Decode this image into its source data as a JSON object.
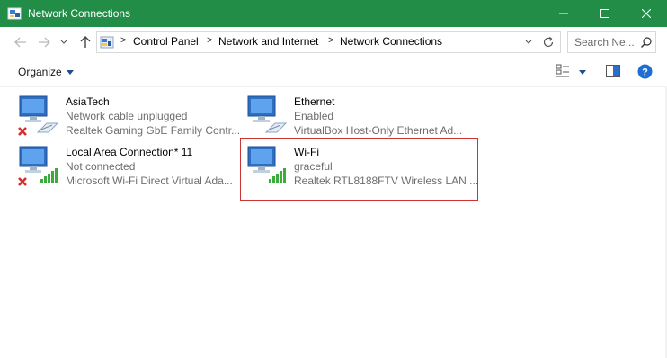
{
  "window": {
    "title": "Network Connections",
    "accent_color": "#218d47",
    "controls": [
      "minimize-icon",
      "maximize-icon",
      "close-icon"
    ]
  },
  "address_bar": {
    "breadcrumbs": [
      "Control Panel",
      "Network and Internet",
      "Network Connections"
    ],
    "search_placeholder": "Search Ne..."
  },
  "command_bar": {
    "organize_label": "Organize"
  },
  "connections": [
    {
      "name": "AsiaTech",
      "status": "Network cable unplugged",
      "device": "Realtek Gaming GbE Family Contr...",
      "type": "ethernet",
      "disconnected": true
    },
    {
      "name": "Ethernet",
      "status": "Enabled",
      "device": "VirtualBox Host-Only Ethernet Ad...",
      "type": "ethernet",
      "disconnected": false
    },
    {
      "name": "Local Area Connection* 11",
      "status": "Not connected",
      "device": "Microsoft Wi-Fi Direct Virtual Ada...",
      "type": "wifi",
      "disconnected": true
    },
    {
      "name": "Wi-Fi",
      "status": "graceful",
      "device": "Realtek RTL8188FTV Wireless LAN ...",
      "type": "wifi",
      "disconnected": false,
      "highlighted": true
    }
  ],
  "colors": {
    "highlight_border": "#cc3333",
    "disconnected_mark": "#d32f2f",
    "signal_bars": "#3cad3c",
    "help_icon": "#1f6fd1"
  }
}
